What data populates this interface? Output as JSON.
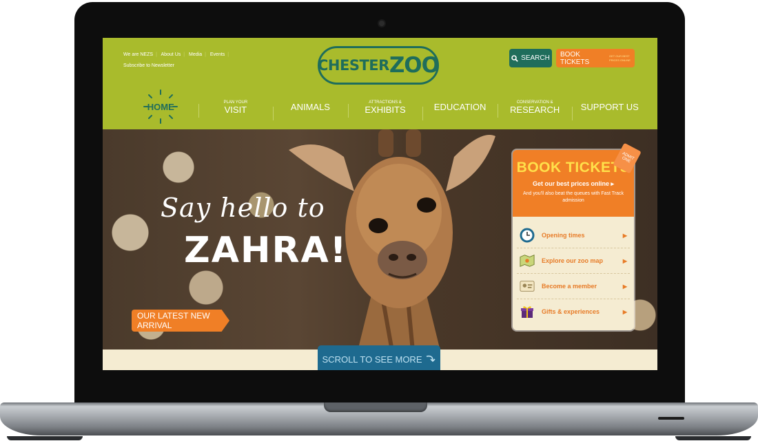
{
  "top_links": [
    "We are NEZS",
    "About Us",
    "Media",
    "Events",
    "Subscribe to Newsletter"
  ],
  "logo": {
    "part1": "CHESTER",
    "part2": "ZOO"
  },
  "search": {
    "label": "SEARCH"
  },
  "book_top": {
    "label": "BOOK TICKETS",
    "tag": "GET OUR BEST PRICES ONLINE"
  },
  "nav": {
    "home": "HOME",
    "items": [
      {
        "small": "PLAN YOUR",
        "big": "VISIT"
      },
      {
        "small": "",
        "big": "ANIMALS"
      },
      {
        "small": "ATTRACTIONS &",
        "big": "EXHIBITS"
      },
      {
        "small": "",
        "big": "EDUCATION"
      },
      {
        "small": "CONSERVATION &",
        "big": "RESEARCH"
      },
      {
        "small": "",
        "big": "SUPPORT US"
      }
    ]
  },
  "hero": {
    "line1": "Say hello to",
    "line2": "ZAHRA!",
    "button": "OUR LATEST NEW ARRIVAL"
  },
  "panel": {
    "title": "BOOK TICKETS",
    "subtitle": "Get our best prices online ▸",
    "note": "And you'll also beat the queues with Fast Track admission",
    "badge": "ADMIT ONE",
    "links": [
      {
        "label": "Opening times",
        "icon": "clock-icon"
      },
      {
        "label": "Explore our zoo map",
        "icon": "map-icon"
      },
      {
        "label": "Become a member",
        "icon": "member-card-icon"
      },
      {
        "label": "Gifts & experiences",
        "icon": "gift-icon"
      }
    ]
  },
  "scroll": {
    "label": "SCROLL TO SEE MORE"
  },
  "colors": {
    "green": "#a9bb2c",
    "teal": "#1f6d5b",
    "orange": "#f07f26",
    "blue": "#1e6a8f",
    "cream": "#f5ecd2"
  }
}
